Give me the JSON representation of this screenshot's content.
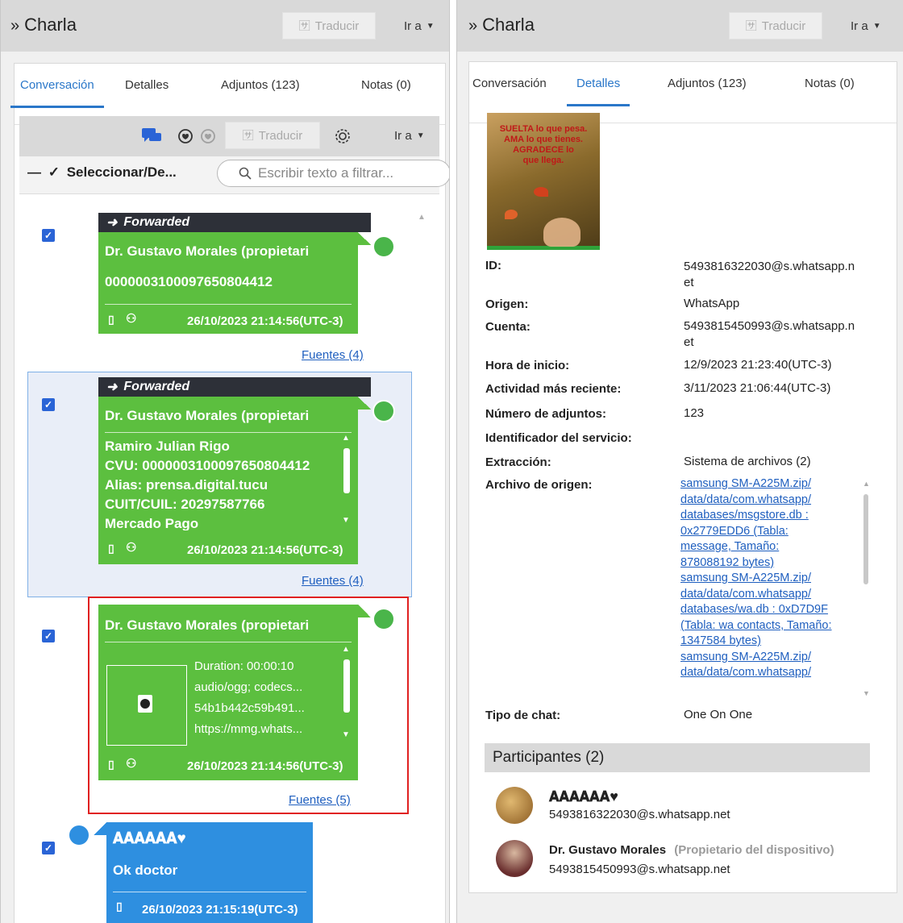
{
  "left": {
    "title": "Charla",
    "translate_label": "Traducir",
    "goto_label": "Ir a",
    "tabs": [
      "Conversación",
      "Detalles",
      "Adjuntos (123)",
      "Notas (0)"
    ],
    "toolbar": {
      "translate_label": "Traducir",
      "goto_label": "Ir a"
    },
    "select_label": "Seleccionar/De...",
    "search_placeholder": "Escribir texto a filtrar...",
    "messages": [
      {
        "forwarded_label": "Forwarded",
        "sender": "Dr. Gustavo Morales (propietari",
        "body": "0000003100097650804412",
        "timestamp": "26/10/2023 21:14:56(UTC-3)",
        "sources": "Fuentes (4)"
      },
      {
        "forwarded_label": "Forwarded",
        "sender": "Dr. Gustavo Morales (propietari",
        "lines": [
          "Ramiro Julian Rigo",
          "CVU: 0000003100097650804412",
          "Alias: prensa.digital.tucu",
          "CUIT/CUIL: 20297587766",
          "Mercado Pago"
        ],
        "timestamp": "26/10/2023 21:14:56(UTC-3)",
        "sources": "Fuentes (4)"
      },
      {
        "sender": "Dr. Gustavo Morales (propietari",
        "attachment_lines": [
          "Duration: 00:00:10",
          "audio/ogg; codecs...",
          "54b1b442c59b491...",
          "https://mmg.whats..."
        ],
        "timestamp": "26/10/2023 21:14:56(UTC-3)",
        "sources": "Fuentes (5)"
      },
      {
        "sender": "𝐀𝐀𝐀𝐀𝐀𝐀♥",
        "body": "Ok doctor",
        "timestamp": "26/10/2023 21:15:19(UTC-3)"
      }
    ]
  },
  "right": {
    "title": "Charla",
    "translate_label": "Traducir",
    "goto_label": "Ir a",
    "tabs": [
      "Conversación",
      "Detalles",
      "Adjuntos (123)",
      "Notas (0)"
    ],
    "image_text": [
      "SUELTA lo que pesa.",
      "AMA lo que tienes.",
      "AGRADECE lo",
      "que llega."
    ],
    "details": [
      {
        "label": "ID:",
        "value": "5493816322030@s.whatsapp.net"
      },
      {
        "label": "Origen:",
        "value": "WhatsApp"
      },
      {
        "label": "Cuenta:",
        "value": "5493815450993@s.whatsapp.net"
      },
      {
        "label": "Hora de inicio:",
        "value": "12/9/2023 21:23:40(UTC-3)"
      },
      {
        "label": "Actividad más reciente:",
        "value": "3/11/2023 21:06:44(UTC-3)"
      },
      {
        "label": "Número de adjuntos:",
        "value": "123"
      },
      {
        "label": "Identificador del servicio:",
        "value": ""
      },
      {
        "label": "Extracción:",
        "value": "Sistema de archivos (2)"
      },
      {
        "label": "Archivo de origen:",
        "value": ""
      },
      {
        "label": "Tipo de chat:",
        "value": "One On One"
      }
    ],
    "source_file_lines": [
      "samsung SM-A225M.zip/",
      "data/data/com.whatsapp/",
      "databases/msgstore.db :",
      "0x2779EDD6 (Tabla:",
      "message, Tamaño:",
      "878088192 bytes)",
      "samsung SM-A225M.zip/",
      "data/data/com.whatsapp/",
      "databases/wa.db : 0xD7D9F",
      "(Tabla: wa contacts, Tamaño:",
      "1347584 bytes)",
      "samsung SM-A225M.zip/",
      "data/data/com.whatsapp/"
    ],
    "participants_header": "Participantes (2)",
    "participants": [
      {
        "name": "𝐀𝐀𝐀𝐀𝐀𝐀♥",
        "role": "",
        "jid": "5493816322030@s.whatsapp.net"
      },
      {
        "name": "Dr. Gustavo Morales",
        "role": "(Propietario del dispositivo)",
        "jid": "5493815450993@s.whatsapp.net"
      }
    ]
  }
}
